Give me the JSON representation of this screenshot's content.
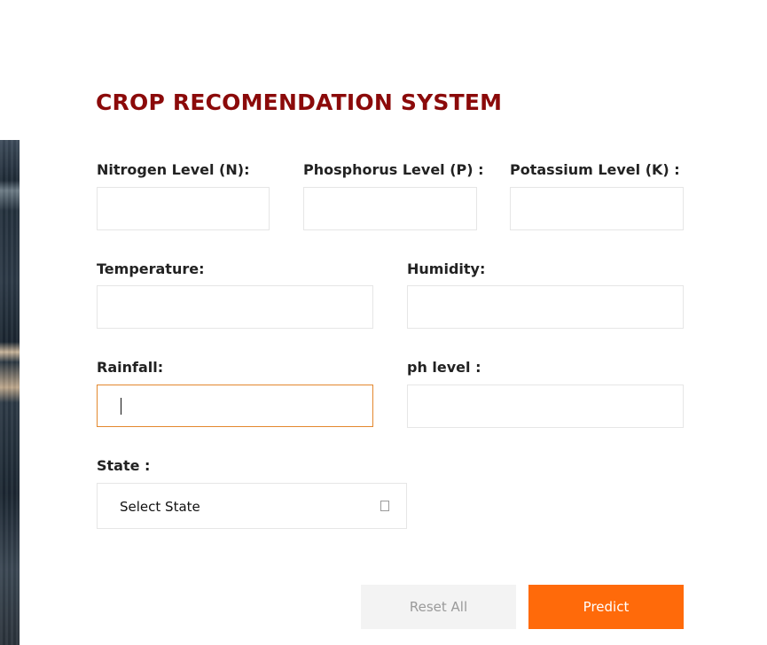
{
  "form": {
    "title": "CROP RECOMENDATION SYSTEM",
    "fields": {
      "nitrogen": {
        "label": "Nitrogen Level (N):",
        "value": ""
      },
      "phosphorus": {
        "label": "Phosphorus Level (P) :",
        "value": ""
      },
      "potassium": {
        "label": "Potassium Level (K) :",
        "value": ""
      },
      "temperature": {
        "label": "Temperature:",
        "value": ""
      },
      "humidity": {
        "label": "Humidity:",
        "value": ""
      },
      "rainfall": {
        "label": "Rainfall:",
        "value": "",
        "focused": true
      },
      "ph": {
        "label": "ph level :",
        "value": ""
      }
    },
    "state": {
      "label": "State :",
      "selected": "Select State",
      "icon": "dropdown-box-icon"
    },
    "buttons": {
      "reset_label": "Reset All",
      "predict_label": "Predict"
    }
  },
  "colors": {
    "title": "#8b0a0a",
    "accent": "#ff6a0a",
    "focus_border": "#e3882e",
    "reset_bg": "#f3f3f3"
  }
}
